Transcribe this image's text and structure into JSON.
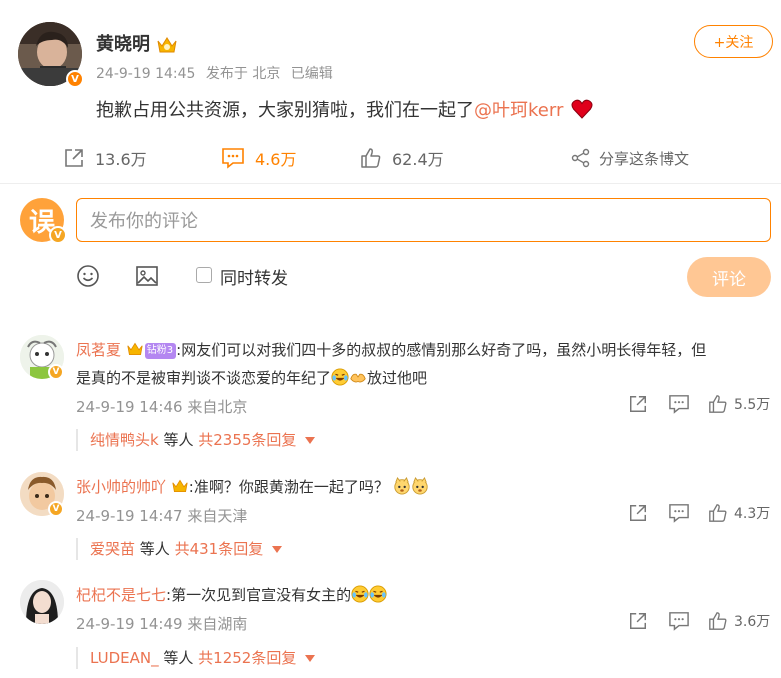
{
  "post": {
    "author": "黄晓明",
    "date": "24-9-19 14:45",
    "location": "发布于 北京",
    "edited": "已编辑",
    "text": "抱歉占用公共资源，大家别猜啦，我们在一起了",
    "mention": "@叶珂kerr",
    "follow_label": "+关注",
    "verified_badge": "V",
    "reposts": "13.6万",
    "comments": "4.6万",
    "likes": "62.4万",
    "share_label": "分享这条博文"
  },
  "composer": {
    "placeholder": "发布你的评论",
    "sync_label": "同时转发",
    "submit_label": "评论",
    "avatar_char": "误"
  },
  "comments": [
    {
      "user": "凤茗夏",
      "fan_badge": "钻粉3",
      "text_line1": ":网友们可以对我们四十多的叔叔的感情别那么好奇了吗，虽然小明长得年轻，但",
      "text_line2": "是真的不是被审判谈不谈恋爱的年纪了",
      "text_tail": "放过他吧",
      "time": "24-9-19 14:46",
      "source": "来自北京",
      "likes": "5.5万",
      "reply_user": "纯情鸭头k",
      "reply_mid": " 等人 ",
      "reply_count": "共2355条回复"
    },
    {
      "user": "张小帅的帅吖",
      "text_line1": ":准啊？你跟黄渤在一起了吗？",
      "time": "24-9-19 14:47",
      "source": "来自天津",
      "likes": "4.3万",
      "reply_user": "爱哭苗",
      "reply_mid": " 等人 ",
      "reply_count": "共431条回复"
    },
    {
      "user": "杞杞不是七七",
      "text_line1": ":第一次见到官宣没有女主的",
      "time": "24-9-19 14:49",
      "source": "来自湖南",
      "likes": "3.6万",
      "reply_user": "LUDEAN_",
      "reply_mid": " 等人 ",
      "reply_count": "共1252条回复"
    }
  ],
  "colors": {
    "accent": "#ff8200",
    "link": "#eb7350",
    "muted": "#939393",
    "submit_disabled": "#ffc794"
  }
}
